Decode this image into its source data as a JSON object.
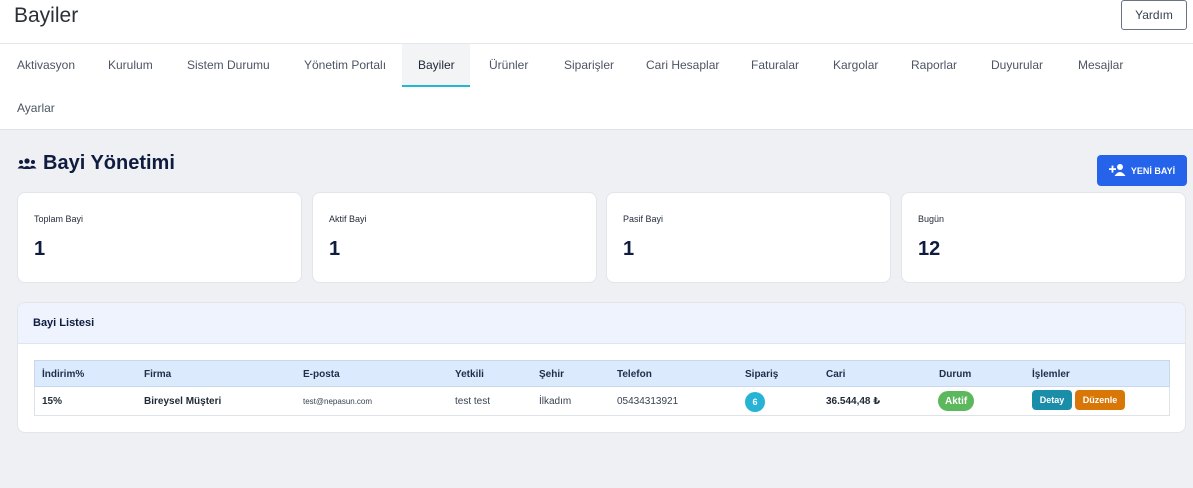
{
  "header": {
    "title": "Bayiler",
    "help_label": "Yardım"
  },
  "tabs": [
    {
      "label": "Aktivasyon"
    },
    {
      "label": "Kurulum"
    },
    {
      "label": "Sistem Durumu"
    },
    {
      "label": "Yönetim Portalı"
    },
    {
      "label": "Bayiler",
      "active": true
    },
    {
      "label": "Ürünler"
    },
    {
      "label": "Siparişler"
    },
    {
      "label": "Cari Hesaplar"
    },
    {
      "label": "Faturalar"
    },
    {
      "label": "Kargolar"
    },
    {
      "label": "Raporlar"
    },
    {
      "label": "Duyurular"
    },
    {
      "label": "Mesajlar"
    },
    {
      "label": "Ayarlar"
    }
  ],
  "section": {
    "title": "Bayi Yönetimi",
    "new_button": "YENİ BAYİ",
    "icon": "users-icon"
  },
  "stats": [
    {
      "label": "Toplam Bayi",
      "value": "1"
    },
    {
      "label": "Aktif Bayi",
      "value": "1"
    },
    {
      "label": "Pasif Bayi",
      "value": "1"
    },
    {
      "label": "Bugün",
      "value": "12"
    }
  ],
  "dealer_list": {
    "title": "Bayi Listesi",
    "columns": [
      "İndirim%",
      "Firma",
      "E-posta",
      "Yetkili",
      "Şehir",
      "Telefon",
      "Sipariş",
      "Cari",
      "Durum",
      "İşlemler"
    ],
    "rows": [
      {
        "discount": "15%",
        "company": "Bireysel Müşteri",
        "email": "test@nepasun.com",
        "contact": "test test",
        "city": "İlkadım",
        "phone": "05434313921",
        "orders": "6",
        "balance": "36.544,48 ₺",
        "status": "Aktif",
        "detail_label": "Detay",
        "edit_label": "Düzenle"
      }
    ]
  },
  "colors": {
    "accent": "#22b8cf",
    "primary_button": "#2563eb",
    "detail_button": "#1a8ea8",
    "edit_button": "#d97706",
    "status_active": "#5cb85c",
    "order_badge": "#26b3d6"
  }
}
